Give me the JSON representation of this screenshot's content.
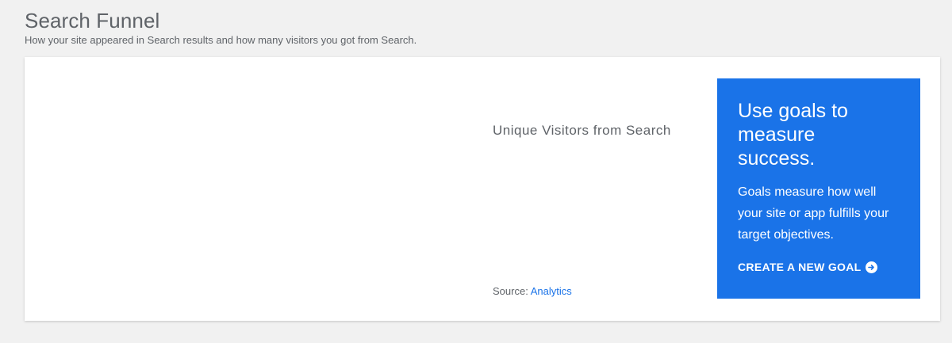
{
  "header": {
    "title": "Search Funnel",
    "subtitle": "How your site appeared in Search results and how many visitors you got from Search."
  },
  "card": {
    "metric_title": "Unique Visitors from Search",
    "source_prefix": "Source: ",
    "source_link": "Analytics"
  },
  "promo": {
    "heading": "Use goals to measure success.",
    "body": "Goals measure how well your site or app fulfills your target objectives.",
    "cta_label": "CREATE A NEW GOAL",
    "cta_icon": "arrow-right-circle-icon",
    "background_color": "#1a73e8"
  },
  "colors": {
    "link": "#1a73e8",
    "text_secondary": "#5f6368",
    "page_background": "#f1f1f1"
  }
}
